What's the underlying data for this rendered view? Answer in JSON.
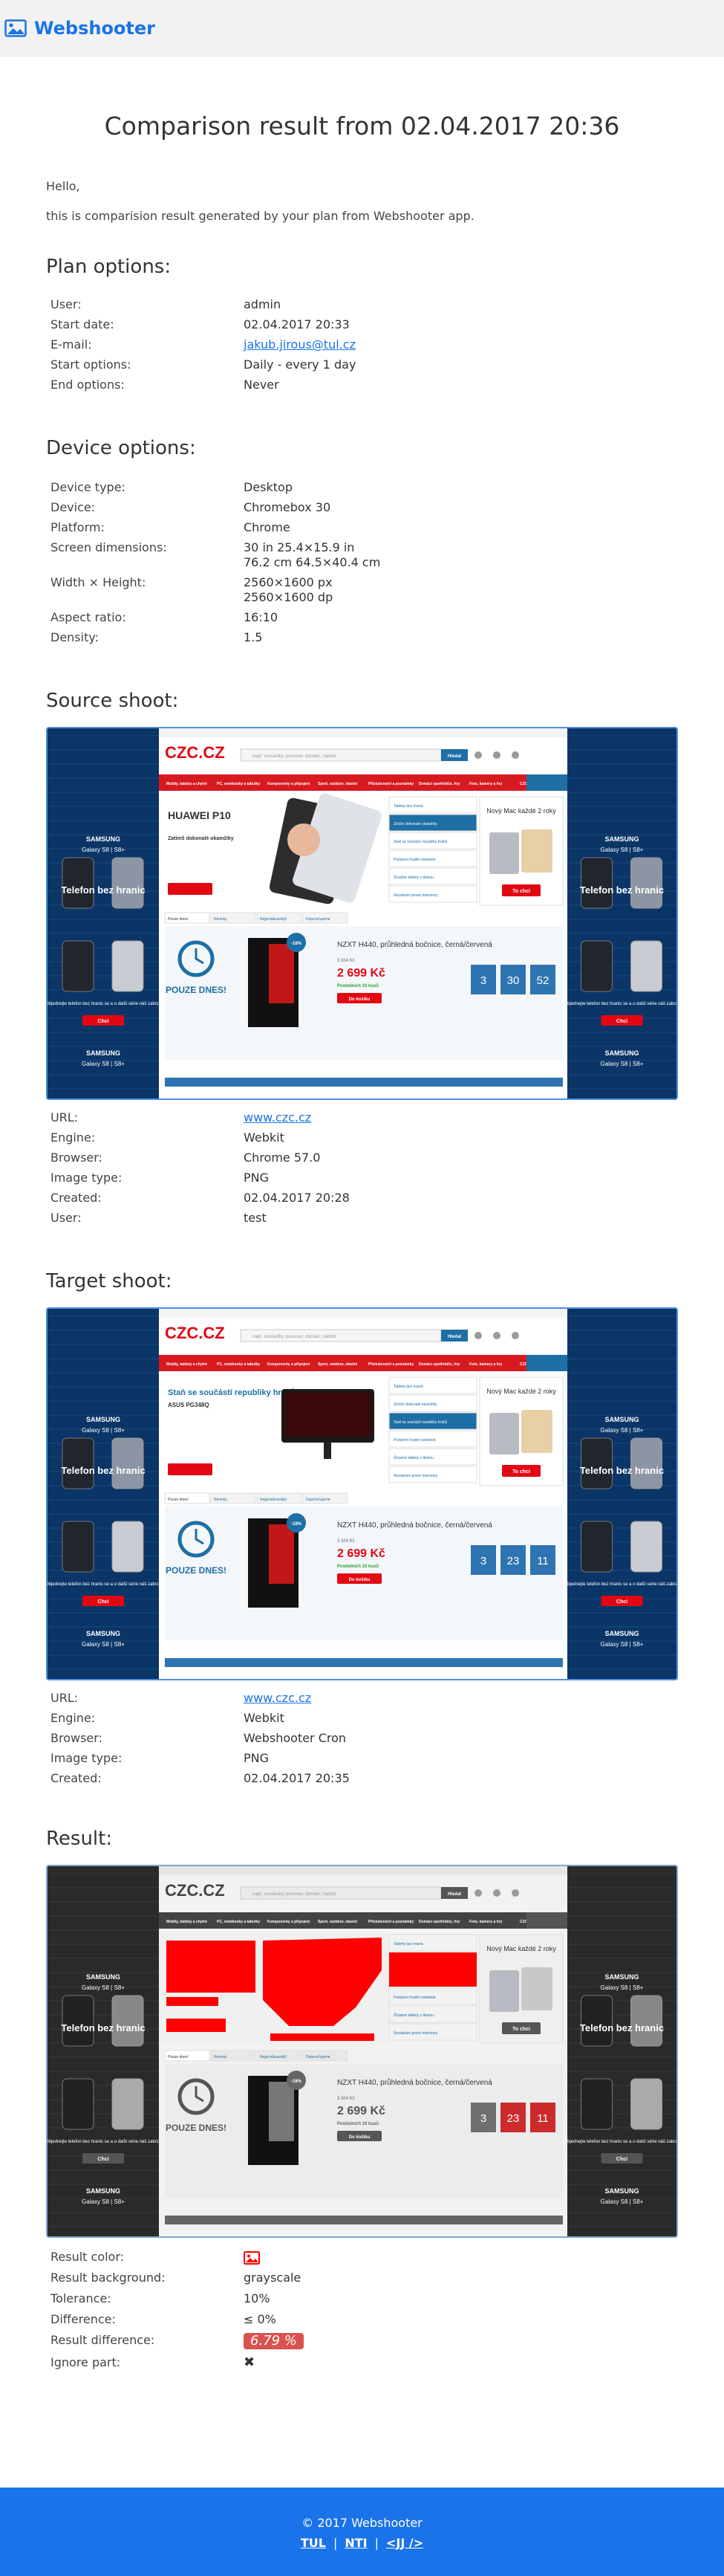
{
  "brand": {
    "name": "Webshooter"
  },
  "title": "Comparison result from 02.04.2017 20:36",
  "intro": {
    "greeting": "Hello,",
    "text": "this is comparision result generated by your plan from Webshooter app."
  },
  "plan": {
    "heading": "Plan options:",
    "rows": [
      {
        "label": "User:",
        "value": "admin"
      },
      {
        "label": "Start date:",
        "value": "02.04.2017 20:33"
      },
      {
        "label": "E-mail:",
        "value": "jakub.jirous@tul.cz"
      },
      {
        "label": "Start options:",
        "value": "Daily - every 1 day"
      },
      {
        "label": "End options:",
        "value": "Never"
      }
    ]
  },
  "device": {
    "heading": "Device options:",
    "device_type_label": "Device type:",
    "device_type": "Desktop",
    "device_label": "Device:",
    "device": "Chromebox 30",
    "platform_label": "Platform:",
    "platform": "Chrome",
    "screen_label": "Screen dimensions:",
    "screen_in": "30 in 25.4×15.9 in",
    "screen_cm": "76.2 cm 64.5×40.4 cm",
    "wh_label": "Width × Height:",
    "wh_px": "2560×1600 px",
    "wh_dp": "2560×1600 dp",
    "aspect_label": "Aspect ratio:",
    "aspect": "16:10",
    "density_label": "Density:",
    "density": "1.5"
  },
  "source": {
    "heading": "Source shoot:",
    "url_label": "URL:",
    "url": "www.czc.cz",
    "engine_label": "Engine:",
    "engine": "Webkit",
    "browser_label": "Browser:",
    "browser": "Chrome 57.0",
    "imgtype_label": "Image type:",
    "imgtype": "PNG",
    "created_label": "Created:",
    "created": "02.04.2017 20:28",
    "user_label": "User:",
    "user": "test",
    "shot": {
      "hero": "HUAWEI P10",
      "hero_sub": "Zatímš dokonalé okamžiky",
      "countdown": [
        "3",
        "30",
        "52"
      ]
    }
  },
  "target": {
    "heading": "Target shoot:",
    "url_label": "URL:",
    "url": "www.czc.cz",
    "engine_label": "Engine:",
    "engine": "Webkit",
    "browser_label": "Browser:",
    "browser": "Webshooter Cron",
    "imgtype_label": "Image type:",
    "imgtype": "PNG",
    "created_label": "Created:",
    "created": "02.04.2017 20:35",
    "shot": {
      "hero": "Staň se součástí republiky hráčů",
      "hero_sub": "ASUS PG348Q",
      "countdown": [
        "3",
        "23",
        "11"
      ]
    }
  },
  "result": {
    "heading": "Result:",
    "color_label": "Result color:",
    "background_label": "Result background:",
    "background": "grayscale",
    "tolerance_label": "Tolerance:",
    "tolerance": "10%",
    "difference_label": "Difference:",
    "difference": "≤ 0%",
    "result_diff_label": "Result difference:",
    "result_diff": "6.79 %",
    "ignore_label": "Ignore part:",
    "ignore_value": "✖",
    "shot": {
      "countdown": [
        "3",
        "23",
        "11"
      ]
    }
  },
  "shared_shot": {
    "logo": "CZC.CZ",
    "side_brand": "SAMSUNG",
    "side_model": "Galaxy S8 | S8+",
    "side_title": "Telefon bez hranic",
    "side_cta": "Objednejte telefon bez hranic se a o další série náš zabrzu",
    "side_btn": "Chci",
    "mac_title": "Nový Mac každé 2 roky",
    "mac_btn": "To chci",
    "product": "NZXT H440, průhledná bočnice, černá/červená",
    "price": "2 699 Kč",
    "old_price": "3 304 Kč",
    "stock": "Posledních 10 kusů",
    "buy": "Do košíku",
    "badge": "-18%",
    "promo": "POUZE DNES!",
    "search_placeholder": "např. soušástky, procesor, domácí, nádobí",
    "search_btn": "Hledat",
    "tabs": [
      "Pouze dnes!",
      "Novinky",
      "Nejprodávanější",
      "Doporučujeme"
    ],
    "menu": [
      "Mobily, tablety a chytré",
      "PC, notebooky a tabulky",
      "Komponenty a připojení",
      "Sport, outdoor, vlastní",
      "Příslušenství a poznámky",
      "Domácí spotřebiče, hry",
      "Foto, kamery a hry",
      "CZC.CZ App a další služby"
    ],
    "sidebar": [
      "Tablety bez hranic",
      "Zločiní dokonalé okamžiky",
      "Staň se součástí republiky hráčů",
      "Podzimní hudbí notebook",
      "Ščastné tablety s školou",
      "Nezabrání pravé televizory"
    ]
  },
  "footer": {
    "copyright": "© 2017 Webshooter",
    "links": [
      "TUL",
      "NTI",
      "<JJ />"
    ],
    "separator": "|"
  },
  "colors": {
    "accent": "#1a73e8",
    "diff_badge": "#d9534f",
    "diff_red": "#ff0000",
    "czc_red": "#e30613",
    "czc_blue": "#1d6fa5"
  }
}
